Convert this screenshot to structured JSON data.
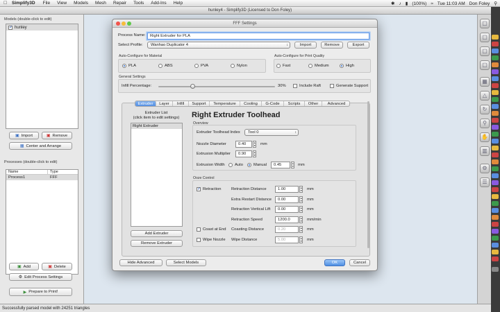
{
  "menubar": {
    "app_name": "Simplify3D",
    "items": [
      "File",
      "View",
      "Models",
      "Mesh",
      "Repair",
      "Tools",
      "Add-Ins",
      "Help"
    ],
    "battery": "(100%)",
    "clock": "Tue 11:03 AM",
    "user": "Don Foley"
  },
  "window": {
    "title": "hunley4 - Simplify3D (Licensed to Don Foley)"
  },
  "models_panel": {
    "title": "Models (double-click to edit)",
    "items": [
      {
        "name": "hunley",
        "checked": true
      }
    ],
    "import_label": "Import",
    "remove_label": "Remove",
    "center_label": "Center and Arrange"
  },
  "processes_panel": {
    "title": "Processes (double-click to edit)",
    "col_name": "Name",
    "col_type": "Type",
    "rows": [
      {
        "name": "Process1",
        "type": "FFF"
      }
    ],
    "add_label": "Add",
    "delete_label": "Delete",
    "edit_label": "Edit Process Settings",
    "prepare_label": "Prepare to Print!"
  },
  "status_bar": {
    "text": "Successfully parsed model with 24251 triangles"
  },
  "dialog": {
    "title": "FFF Settings",
    "process_name_label": "Process Name:",
    "process_name_value": "Right Extruder for PLA",
    "select_profile_label": "Select Profile:",
    "profile_value": "Wanhao Duplicator 4",
    "import_label": "Import",
    "remove_label": "Remove",
    "export_label": "Export",
    "material": {
      "title": "Auto-Configure for Material",
      "options": [
        "PLA",
        "ABS",
        "PVA",
        "Nylon"
      ],
      "selected": "PLA"
    },
    "quality": {
      "title": "Auto-Configure for Print Quality",
      "options": [
        "Fast",
        "Medium",
        "High"
      ],
      "selected": "High"
    },
    "general": {
      "title": "General Settings",
      "infill_label": "Infill Percentage:",
      "infill_value": "30%",
      "infill_fraction": 0.3,
      "raft_label": "Include Raft",
      "support_label": "Generate Support"
    },
    "tabs": [
      "Extruder",
      "Layer",
      "Infill",
      "Support",
      "Temperature",
      "Cooling",
      "G-Code",
      "Scripts",
      "Other",
      "Advanced"
    ],
    "active_tab": "Extruder",
    "extruder_list": {
      "title_line1": "Extruder List",
      "title_line2": "(click item to edit settings)",
      "items": [
        "Right Extruder"
      ],
      "add_label": "Add Extruder",
      "remove_label": "Remove Extruder"
    },
    "toolhead": {
      "heading": "Right Extruder Toolhead",
      "overview_title": "Overview",
      "index_label": "Extruder Toolhead Index",
      "index_value": "Tool 0",
      "nozzle_label": "Nozzle Diameter",
      "nozzle_value": "0.40",
      "nozzle_unit": "mm",
      "mult_label": "Extrusion Multiplier",
      "mult_value": "0.90",
      "width_label": "Extrusion Width",
      "width_auto": "Auto",
      "width_manual": "Manual",
      "width_value": "0.45",
      "width_unit": "mm"
    },
    "ooze": {
      "title": "Ooze Control",
      "retraction_label": "Retraction",
      "retraction_distance_label": "Retraction Distance",
      "retraction_distance": "1.00",
      "extra_restart_label": "Extra Restart Distance",
      "extra_restart": "0.00",
      "vertical_lift_label": "Retraction Vertical Lift",
      "vertical_lift": "0.00",
      "speed_label": "Retraction Speed",
      "speed": "1200.0",
      "mm": "mm",
      "mm_min": "mm/min",
      "coast_label": "Coast at End",
      "coasting_distance_label": "Coasting Distance",
      "coasting_distance": "0.20",
      "wipe_label": "Wipe Nozzle",
      "wipe_distance_label": "Wipe Distance",
      "wipe_distance": "5.00"
    },
    "hide_advanced_label": "Hide Advanced",
    "select_models_label": "Select Models",
    "ok_label": "OK",
    "cancel_label": "Cancel"
  }
}
